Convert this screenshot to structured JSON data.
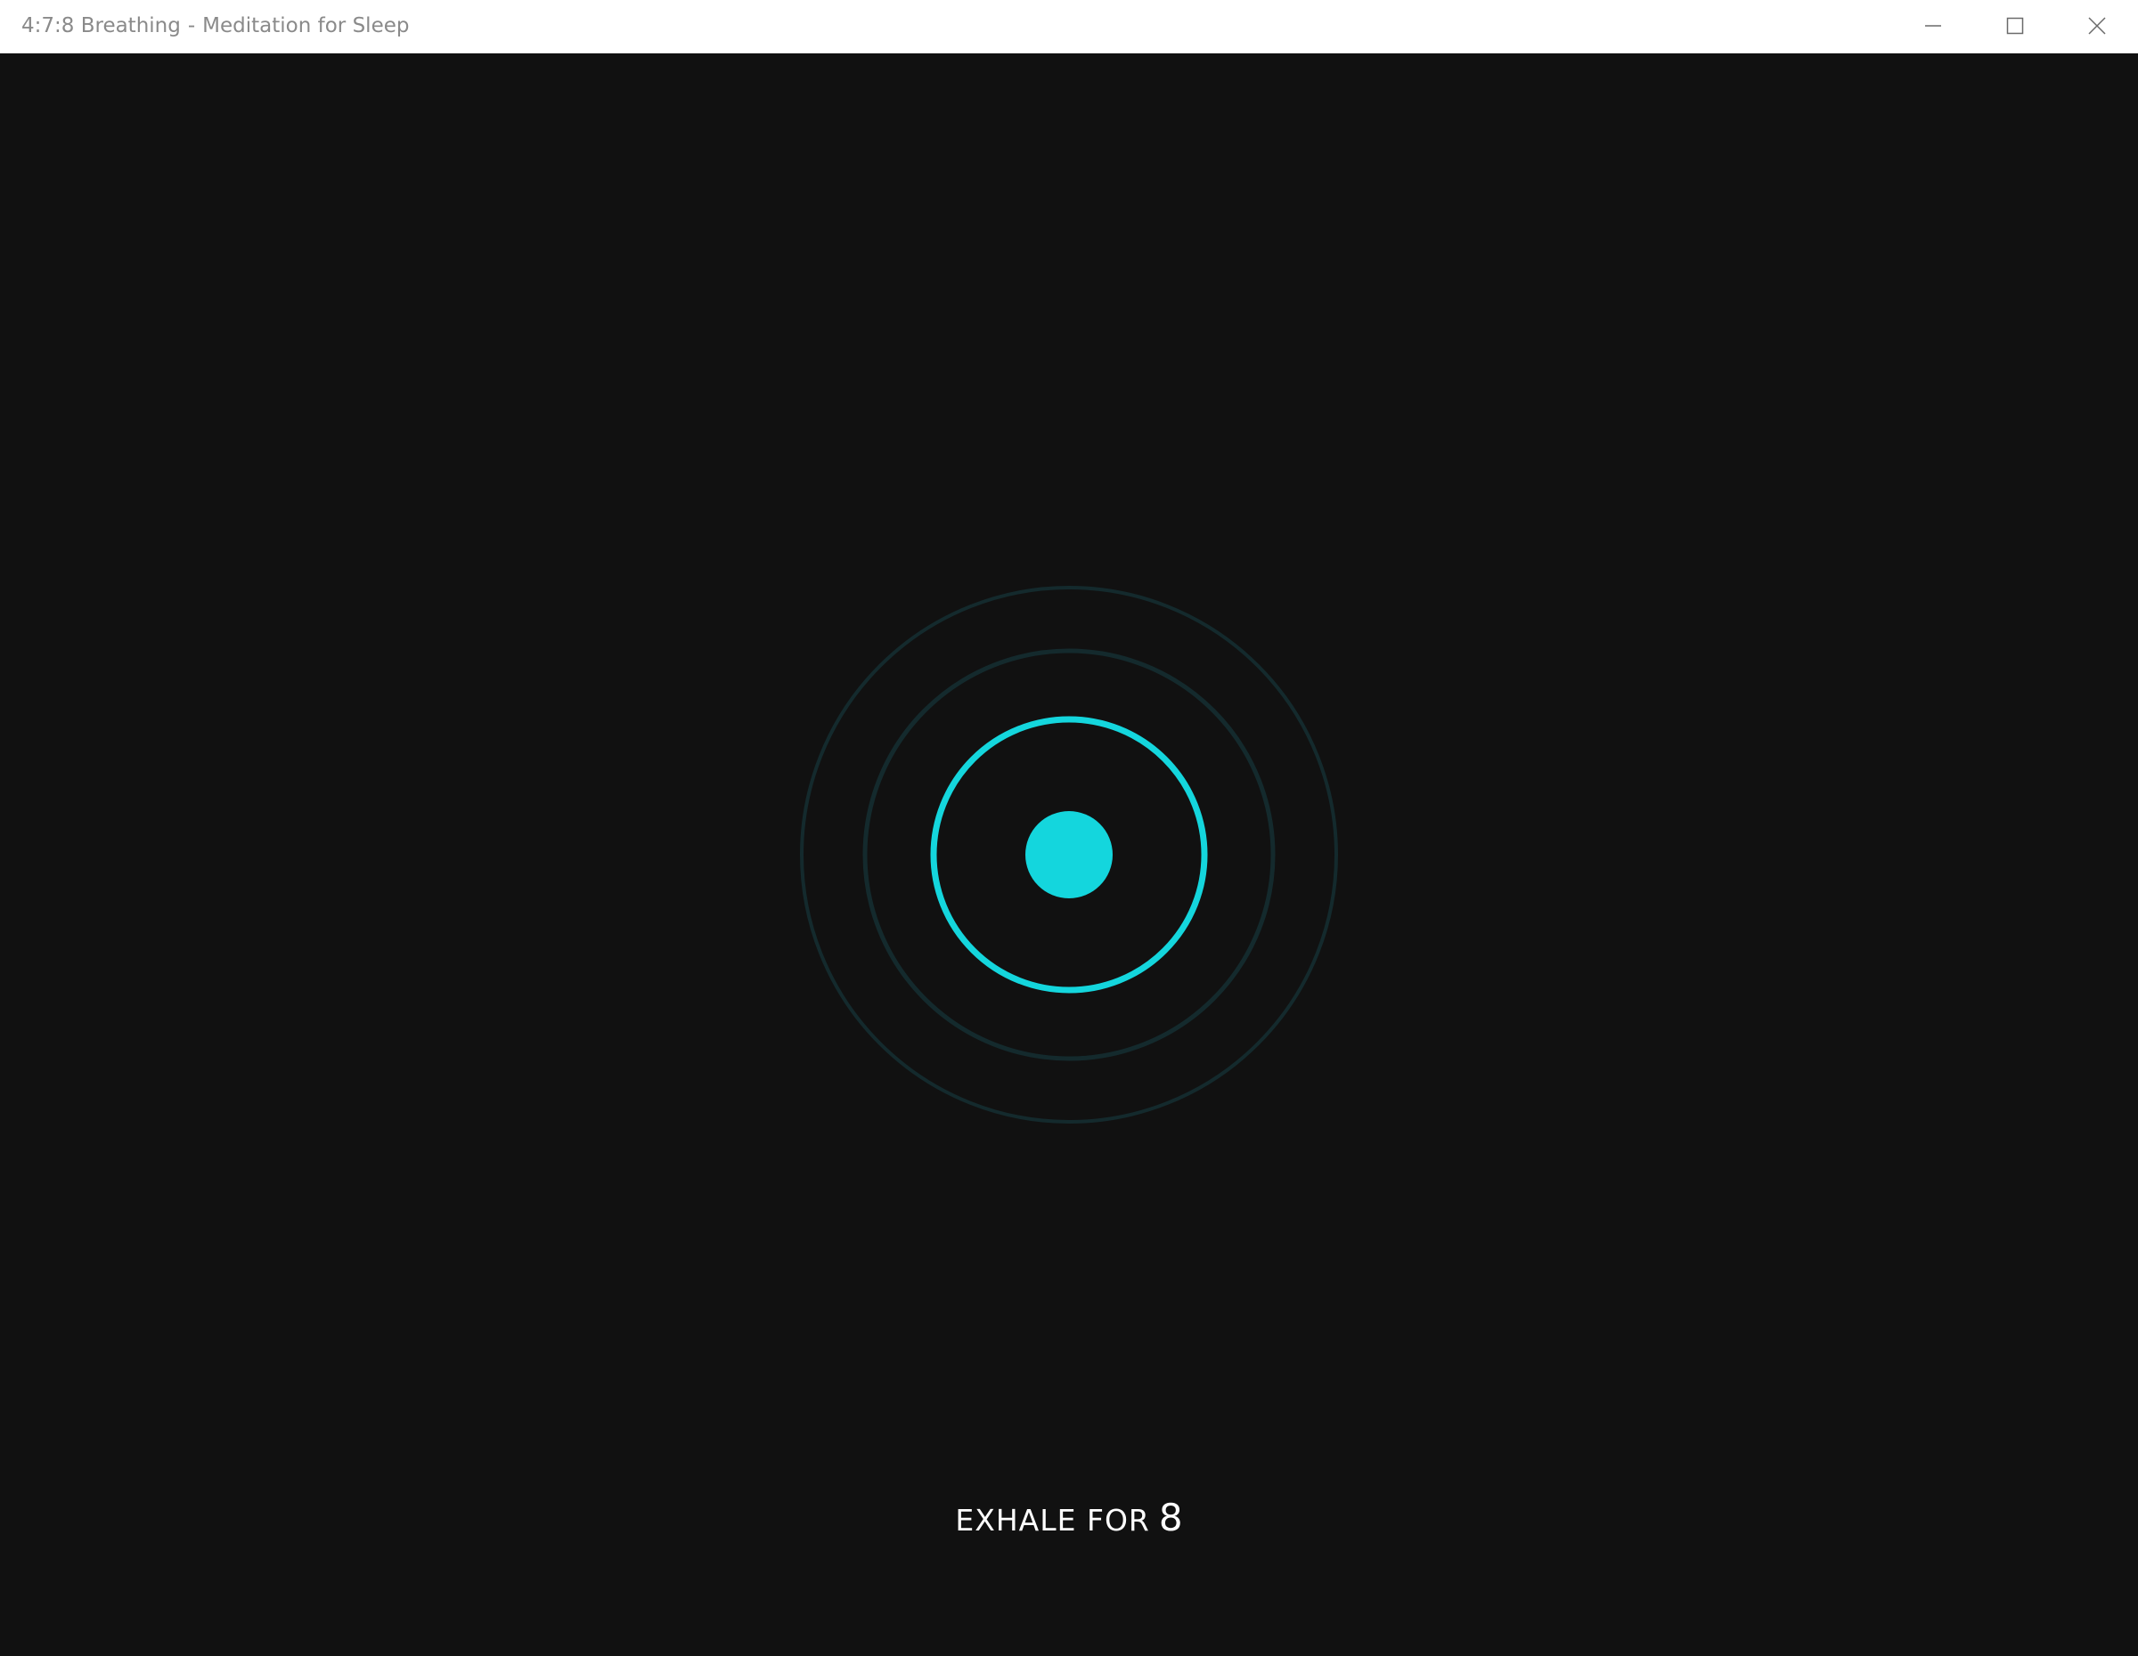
{
  "window": {
    "app_name": "4:7:8 Breathing",
    "separator": "-",
    "subtitle": "Meditation for Sleep",
    "controls": {
      "minimize": "minimize-icon",
      "maximize": "maximize-icon",
      "close": "close-icon"
    }
  },
  "breathing": {
    "phase_label": "EXHALE FOR",
    "seconds": "8",
    "colors": {
      "accent": "#14d6dd",
      "ring_dim": "#142a2d",
      "background": "#111111"
    }
  }
}
